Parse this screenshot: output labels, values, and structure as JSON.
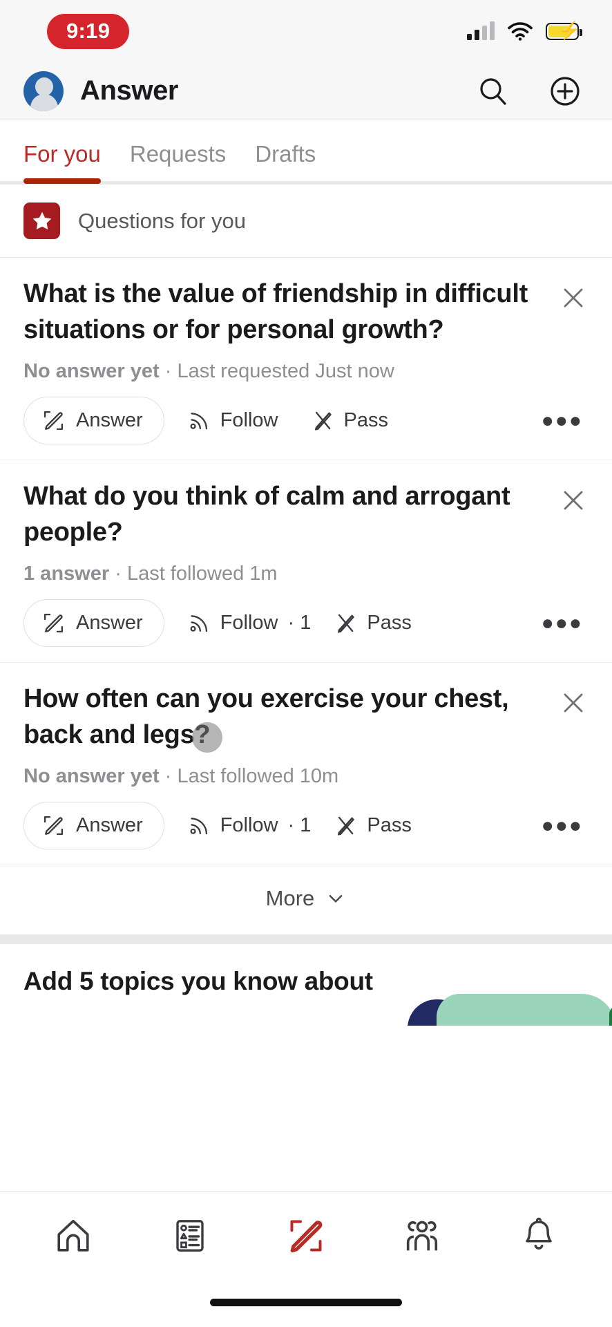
{
  "status_bar": {
    "time": "9:19",
    "signal_icon": "cellular-signal-icon",
    "wifi_icon": "wifi-icon",
    "battery_icon": "battery-charging-icon",
    "battery_color": "#f6d92d",
    "time_pill_color": "#d6242c"
  },
  "header": {
    "app_title": "Answer",
    "avatar_icon": "user-avatar-icon",
    "search_icon": "search-icon",
    "add_icon": "plus-circle-icon"
  },
  "tabs": {
    "items": [
      {
        "label": "For you",
        "active": true
      },
      {
        "label": "Requests",
        "active": false
      },
      {
        "label": "Drafts",
        "active": false
      }
    ],
    "active_color": "#b92b27",
    "indicator_color": "#a82400"
  },
  "section": {
    "label": "Questions for you",
    "icon": "star-icon",
    "icon_bg": "#a61b21"
  },
  "questions": [
    {
      "title": "What is the value of friendship in difficult situations or for personal growth?",
      "answer_status": "No answer yet",
      "meta_separator": "·",
      "meta_detail": "Last requested Just now",
      "answer_label": "Answer",
      "follow_label": "Follow",
      "follow_count": "",
      "pass_label": "Pass",
      "more_icon": "ellipsis-icon",
      "close_icon": "close-icon"
    },
    {
      "title": "What do you think of calm and arrogant people?",
      "answer_status": "1 answer",
      "meta_separator": "·",
      "meta_detail": "Last followed 1m",
      "answer_label": "Answer",
      "follow_label": "Follow",
      "follow_count": "· 1",
      "pass_label": "Pass",
      "more_icon": "ellipsis-icon",
      "close_icon": "close-icon"
    },
    {
      "title": "How often can you exercise your chest, back and legs?",
      "answer_status": "No answer yet",
      "meta_separator": "·",
      "meta_detail": "Last followed 10m",
      "answer_label": "Answer",
      "follow_label": "Follow",
      "follow_count": "· 1",
      "pass_label": "Pass",
      "more_icon": "ellipsis-icon",
      "close_icon": "close-icon"
    }
  ],
  "more_row": {
    "label": "More",
    "icon": "chevron-down-icon"
  },
  "topics": {
    "heading": "Add 5 topics you know about"
  },
  "bottom_nav": {
    "items": [
      {
        "icon": "home-icon",
        "active": false
      },
      {
        "icon": "feed-list-icon",
        "active": false
      },
      {
        "icon": "answer-pencil-icon",
        "active": true
      },
      {
        "icon": "spaces-people-icon",
        "active": false
      },
      {
        "icon": "notifications-bell-icon",
        "active": false
      }
    ],
    "active_color": "#b92b27"
  }
}
